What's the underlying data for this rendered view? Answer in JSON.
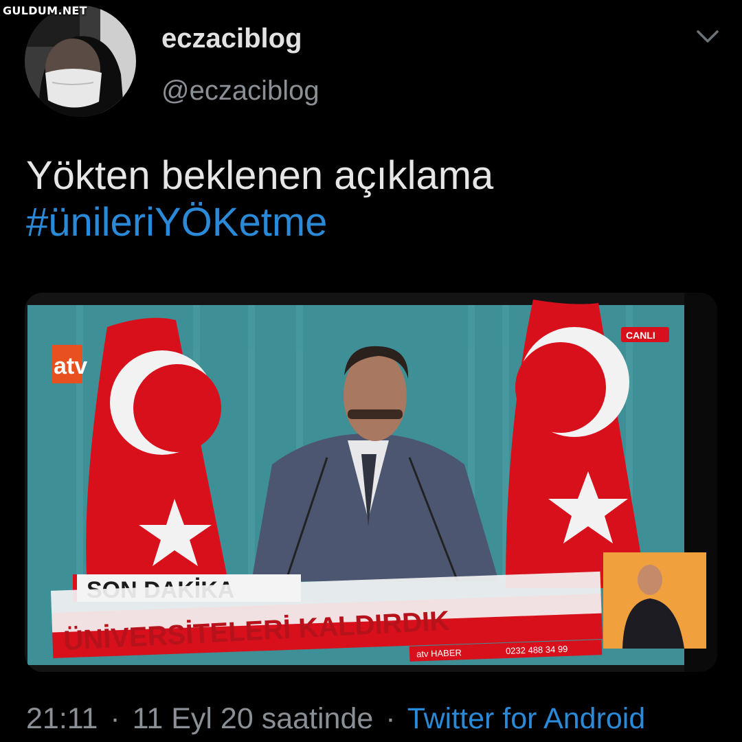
{
  "watermark": "GULDUM.NET",
  "tweet": {
    "display_name": "eczaciblog",
    "handle": "@eczaciblog",
    "text": "Yökten beklenen açıklama",
    "hashtag": "#ünileriYÖKetme",
    "time": "21:11",
    "date": "11 Eyl 20 saatinde",
    "separator": "·",
    "source": "Twitter for Android"
  },
  "media": {
    "channel_logo": "atv",
    "live_badge": "CANLI",
    "breaking_label": "SON DAKİKA",
    "headline": "ÜNİVERSİTELERİ KALDIRDIK",
    "ticker_phone": "0232 488 34 99",
    "ticker_brand": "atv HABER"
  },
  "colors": {
    "background": "#000000",
    "link": "#2a8ad8",
    "flag_red": "#d8101c",
    "studio_teal": "#3f8f96"
  },
  "icons": {
    "menu": "chevron-down-icon"
  }
}
